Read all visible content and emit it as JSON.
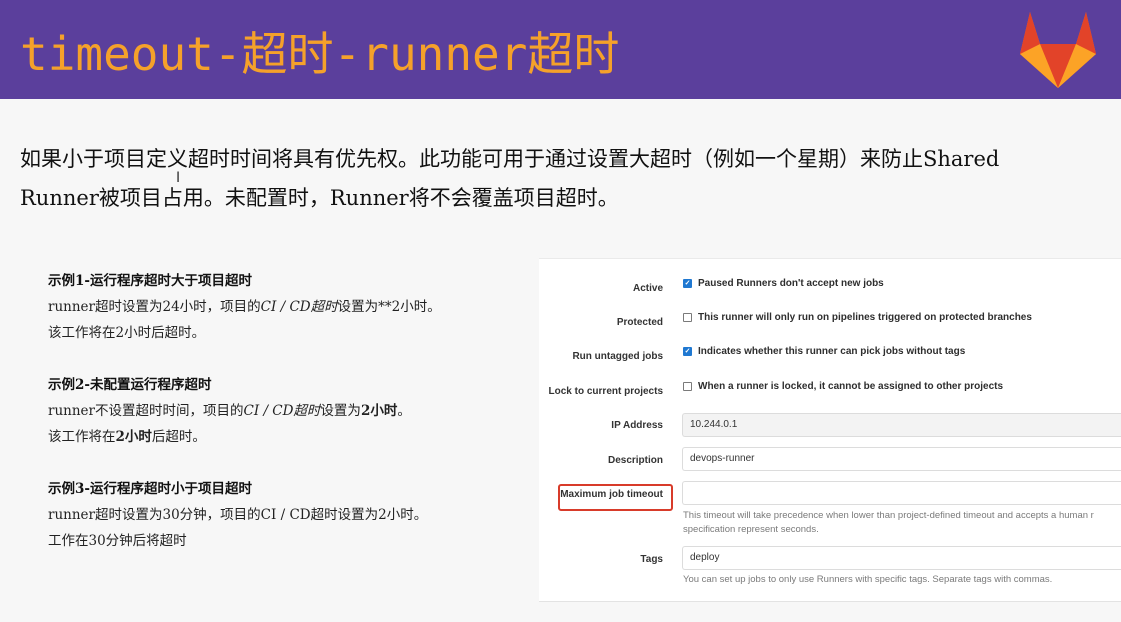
{
  "header": {
    "title": "timeout-超时-runner超时",
    "bg_color": "#5b3f9c",
    "title_color": "#f5a12a",
    "logo": "gitlab-logo"
  },
  "intro": {
    "line1": "如果小于项目定义超时时间将具有优先权。此功能可用于通过设置大超时（例如一个星期）来防止Shared",
    "line2": "Runner被项目占用。未配置时，Runner将不会覆盖项目超时。"
  },
  "cursor": "I",
  "examples": [
    {
      "title": "示例1-运行程序超时大于项目超时",
      "line1_a": "runner超时设置为24小时，项目的",
      "line1_b": "CI / CD超时",
      "line1_c": "设置为**2小时。",
      "line2": "该工作将在2小时后超时。"
    },
    {
      "title": "示例2-未配置运行程序超时",
      "line1_a": "runner不设置超时时间，项目的",
      "line1_b": "CI / CD超时",
      "line1_c": "设置为",
      "line1_d": "2小时",
      "line1_e": "。",
      "line2_a": "该工作将在",
      "line2_b": "2小时",
      "line2_c": "后超时。"
    },
    {
      "title": "示例3-运行程序超时小于项目超时",
      "line1": "runner超时设置为30分钟，项目的CI / CD超时设置为2小时。",
      "line2": "工作在30分钟后将超时"
    }
  ],
  "form": {
    "active": {
      "label": "Active",
      "checked": true,
      "text": "Paused Runners don't accept new jobs"
    },
    "protected": {
      "label": "Protected",
      "checked": false,
      "text": "This runner will only run on pipelines triggered on protected branches"
    },
    "untagged": {
      "label": "Run untagged jobs",
      "checked": true,
      "text": "Indicates whether this runner can pick jobs without tags"
    },
    "locked": {
      "label": "Lock to current projects",
      "checked": false,
      "text": "When a runner is locked, it cannot be assigned to other projects"
    },
    "ip": {
      "label": "IP Address",
      "value": "10.244.0.1"
    },
    "description": {
      "label": "Description",
      "value": "devops-runner"
    },
    "timeout": {
      "label": "Maximum job timeout",
      "value": "",
      "help1": "This timeout will take precedence when lower than project-defined timeout and accepts a human r",
      "help2": "specification represent seconds."
    },
    "tags": {
      "label": "Tags",
      "value": "deploy",
      "help": "You can set up jobs to only use Runners with specific tags. Separate tags with commas."
    },
    "checkbox_color": "#1f78d1",
    "highlight_color": "#d83b2a"
  }
}
